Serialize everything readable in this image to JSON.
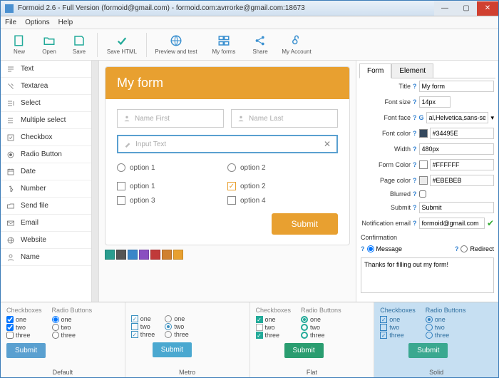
{
  "window": {
    "title": "Formoid 2.6 - Full Version (formoid@gmail.com) - formoid.com:avrrorke@gmail.com:18673"
  },
  "menu": {
    "file": "File",
    "options": "Options",
    "help": "Help"
  },
  "toolbar": {
    "new": "New",
    "open": "Open",
    "save": "Save",
    "savehtml": "Save HTML",
    "preview": "Preview and test",
    "myforms": "My forms",
    "share": "Share",
    "account": "My Account"
  },
  "sidebar": {
    "items": [
      {
        "label": "Text"
      },
      {
        "label": "Textarea"
      },
      {
        "label": "Select"
      },
      {
        "label": "Multiple select"
      },
      {
        "label": "Checkbox"
      },
      {
        "label": "Radio Button"
      },
      {
        "label": "Date"
      },
      {
        "label": "Number"
      },
      {
        "label": "Send file"
      },
      {
        "label": "Email"
      },
      {
        "label": "Website"
      },
      {
        "label": "Name"
      }
    ]
  },
  "form": {
    "title": "My form",
    "name_first": "Name First",
    "name_last": "Name Last",
    "input_text": "Input Text",
    "radio1": "option 1",
    "radio2": "option 2",
    "chk1": "option 1",
    "chk2": "option 2",
    "chk3": "option 3",
    "chk4": "option 4",
    "submit": "Submit"
  },
  "palette": [
    "#2a9d8f",
    "#555",
    "#3a86c8",
    "#8a4fc0",
    "#c03a3a",
    "#d08030",
    "#e8a030"
  ],
  "props": {
    "tab_form": "Form",
    "tab_element": "Element",
    "title_lbl": "Title",
    "title_val": "My form",
    "fontsize_lbl": "Font size",
    "fontsize_val": "14px",
    "fontface_lbl": "Font face",
    "fontface_val": "al,Helvetica,sans-serif",
    "fontcolor_lbl": "Font color",
    "fontcolor_val": "#34495E",
    "width_lbl": "Width",
    "width_val": "480px",
    "formcolor_lbl": "Form Color",
    "formcolor_val": "#FFFFFF",
    "pagecolor_lbl": "Page color",
    "pagecolor_val": "#EBEBEB",
    "blurred_lbl": "Blurred",
    "submit_lbl": "Submit",
    "submit_val": "Submit",
    "email_lbl": "Notification email",
    "email_val": "formoid@gmail.com",
    "confirmation_lbl": "Confirmation",
    "message_lbl": "Message",
    "redirect_lbl": "Redirect",
    "confirm_text": "Thanks for filling out my form!"
  },
  "themes": {
    "chk_head": "Checkboxes",
    "radio_head": "Radio Buttons",
    "one": "one",
    "two": "two",
    "three": "three",
    "submit": "Submit",
    "default": "Default",
    "metro": "Metro",
    "flat": "Flat",
    "solid": "Solid"
  }
}
